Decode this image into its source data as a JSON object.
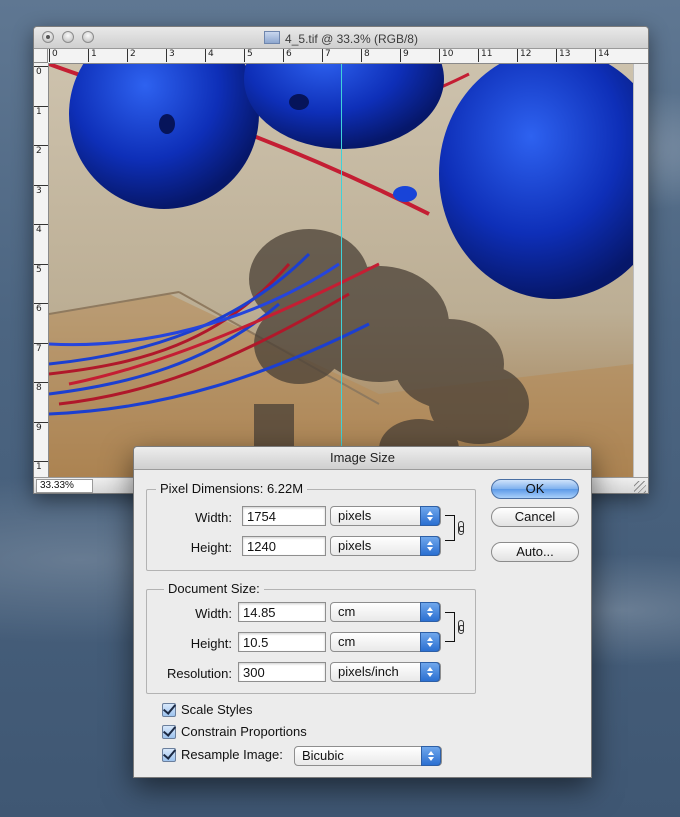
{
  "document_window": {
    "title": "4_5.tif @ 33.3% (RGB/8)",
    "zoom": "33.33%",
    "ruler_h_ticks": [
      "0",
      "1",
      "2",
      "3",
      "4",
      "5",
      "6",
      "7",
      "8",
      "9",
      "10",
      "11",
      "12",
      "13",
      "14"
    ],
    "ruler_v_ticks": [
      "0",
      "1",
      "2",
      "3",
      "4",
      "5",
      "6",
      "7",
      "8",
      "9",
      "1"
    ]
  },
  "dialog": {
    "title": "Image Size",
    "pixel_dimensions": {
      "label": "Pixel Dimensions:",
      "size": "6.22M",
      "width_label": "Width:",
      "width_value": "1754",
      "width_unit": "pixels",
      "height_label": "Height:",
      "height_value": "1240",
      "height_unit": "pixels"
    },
    "document_size": {
      "label": "Document Size:",
      "width_label": "Width:",
      "width_value": "14.85",
      "width_unit": "cm",
      "height_label": "Height:",
      "height_value": "10.5",
      "height_unit": "cm",
      "resolution_label": "Resolution:",
      "resolution_value": "300",
      "resolution_unit": "pixels/inch"
    },
    "options": {
      "scale_styles": "Scale Styles",
      "constrain_proportions": "Constrain Proportions",
      "resample_image": "Resample Image:",
      "resample_method": "Bicubic"
    },
    "buttons": {
      "ok": "OK",
      "cancel": "Cancel",
      "auto": "Auto..."
    }
  }
}
